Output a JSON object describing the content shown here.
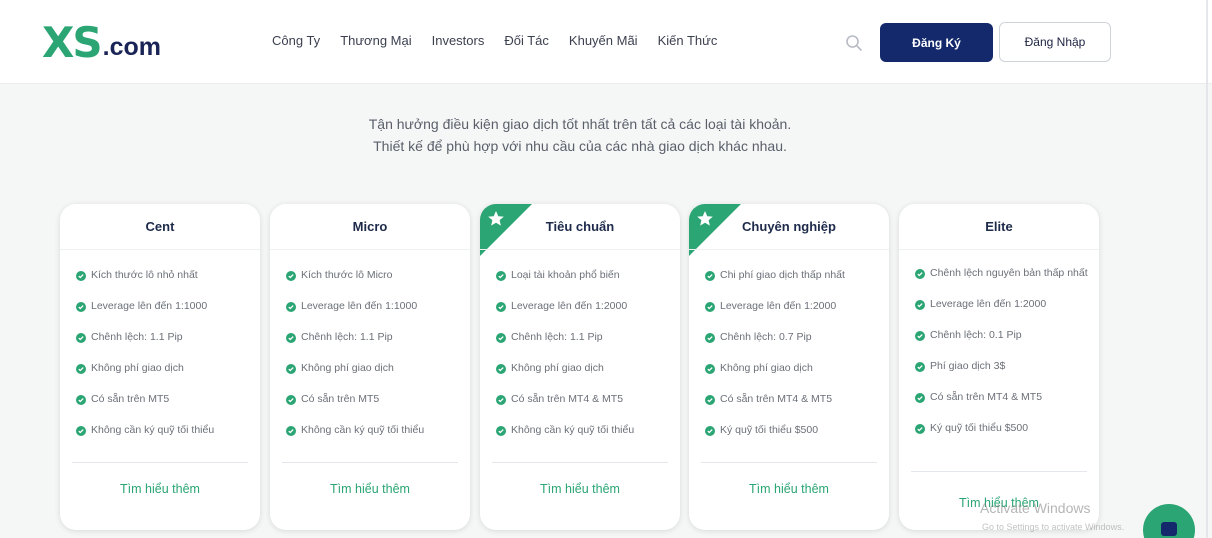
{
  "brand": {
    "logo_primary": "XS",
    "logo_suffix": ".com",
    "color_green": "#2aa573",
    "color_navy": "#13296b"
  },
  "nav": {
    "items": [
      "Công Ty",
      "Thương Mại",
      "Investors",
      "Đối Tác",
      "Khuyến Mãi",
      "Kiến Thức"
    ]
  },
  "header": {
    "search_icon": "search-icon",
    "register_label": "Đăng Ký",
    "login_label": "Đăng Nhập"
  },
  "intro": {
    "line1": "Tận hưởng điều kiện giao dịch tốt nhất trên tất cả các loại tài khoản.",
    "line2": "Thiết kế để phù hợp với nhu cầu của các nhà giao dịch khác nhau."
  },
  "cards": [
    {
      "title": "Cent",
      "featured": false,
      "features": [
        "Kích thước lô nhỏ nhất",
        "Leverage lên đến 1:1000",
        "Chênh lệch: 1.1 Pip",
        "Không phí giao dịch",
        "Có sẵn trên MT5",
        "Không cần ký quỹ tối thiểu"
      ],
      "cta": "Tìm hiểu thêm"
    },
    {
      "title": "Micro",
      "featured": false,
      "features": [
        "Kích thước lô Micro",
        "Leverage lên đến 1:1000",
        "Chênh lệch: 1.1 Pip",
        "Không phí giao dịch",
        "Có sẵn trên MT5",
        "Không cần ký quỹ tối thiểu"
      ],
      "cta": "Tìm hiểu thêm"
    },
    {
      "title": "Tiêu chuẩn",
      "featured": true,
      "features": [
        "Loại tài khoản phổ biến",
        "Leverage lên đến 1:2000",
        "Chênh lệch: 1.1 Pip",
        "Không phí giao dịch",
        "Có sẵn trên MT4 & MT5",
        "Không cần ký quỹ tối thiểu"
      ],
      "cta": "Tìm hiểu thêm"
    },
    {
      "title": "Chuyên nghiệp",
      "featured": true,
      "features": [
        "Chi phí giao dịch thấp nhất",
        "Leverage lên đến 1:2000",
        "Chênh lệch: 0.7 Pip",
        "Không phí giao dịch",
        "Có sẵn trên MT4 & MT5",
        "Ký quỹ tối thiểu $500"
      ],
      "cta": "Tìm hiểu thêm"
    },
    {
      "title": "Elite",
      "featured": false,
      "features": [
        "Chênh lệch nguyên bản thấp nhất",
        "Leverage lên đến 1:2000",
        "Chênh lệch: 0.1 Pip",
        "Phí giao dịch 3$",
        "Có sẵn trên MT4 & MT5",
        "Ký quỹ tối thiểu $500"
      ],
      "cta": "Tìm hiểu thêm"
    }
  ],
  "watermark": {
    "title": "Activate Windows",
    "subtitle": "Go to Settings to activate Windows."
  },
  "chat": {
    "icon": "chat-icon"
  }
}
